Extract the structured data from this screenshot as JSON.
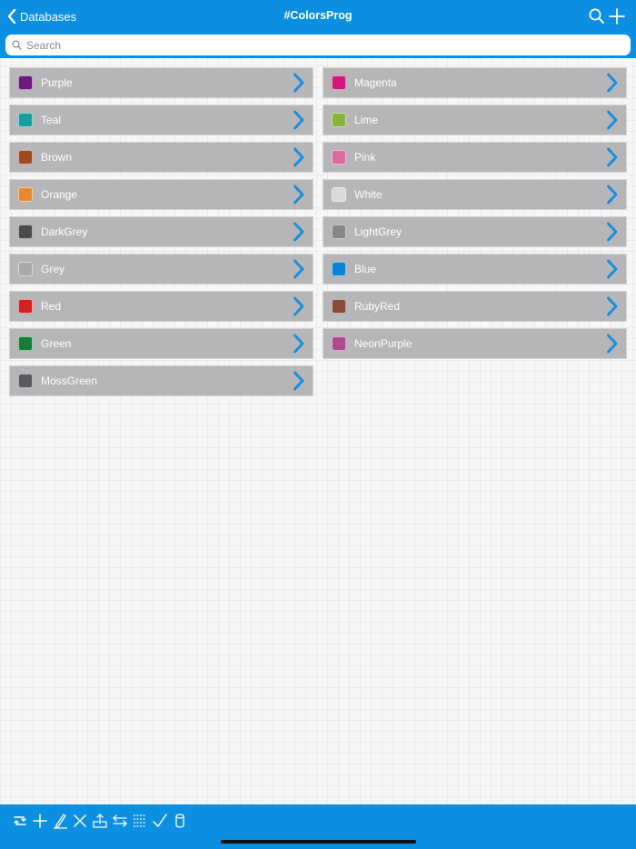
{
  "header": {
    "back_label": "Databases",
    "title": "#ColorsProg",
    "search_icon": "search-icon",
    "add_icon": "plus-icon"
  },
  "search": {
    "placeholder": "Search"
  },
  "colors": {
    "left": [
      {
        "label": "Purple",
        "color": "#6a1b7a"
      },
      {
        "label": "Teal",
        "color": "#12a0a0"
      },
      {
        "label": "Brown",
        "color": "#a04a23"
      },
      {
        "label": "Orange",
        "color": "#e38a2d"
      },
      {
        "label": "DarkGrey",
        "color": "#4c4c4c"
      },
      {
        "label": "Grey",
        "color": "#a9a9a9"
      },
      {
        "label": "Red",
        "color": "#d42020"
      },
      {
        "label": "Green",
        "color": "#157f35"
      },
      {
        "label": "MossGreen",
        "color": "#565a60"
      }
    ],
    "right": [
      {
        "label": "Magenta",
        "color": "#d2187a"
      },
      {
        "label": "Lime",
        "color": "#86b33a"
      },
      {
        "label": "Pink",
        "color": "#d96a9c"
      },
      {
        "label": "White",
        "color": "#d9d9d9"
      },
      {
        "label": "LightGrey",
        "color": "#868686"
      },
      {
        "label": "Blue",
        "color": "#0b82d6"
      },
      {
        "label": "RubyRed",
        "color": "#8a4a38"
      },
      {
        "label": "NeonPurple",
        "color": "#b04a8e"
      }
    ]
  },
  "toolbar": {
    "icons": [
      "refresh-icon",
      "add-icon",
      "edit-icon",
      "delete-icon",
      "export-icon",
      "swap-icon",
      "grid-icon",
      "check-icon",
      "database-icon"
    ]
  },
  "theme": {
    "accent": "#0b8fe0",
    "row_bg": "#b6b6b8",
    "chevron": "#1a8de0"
  }
}
